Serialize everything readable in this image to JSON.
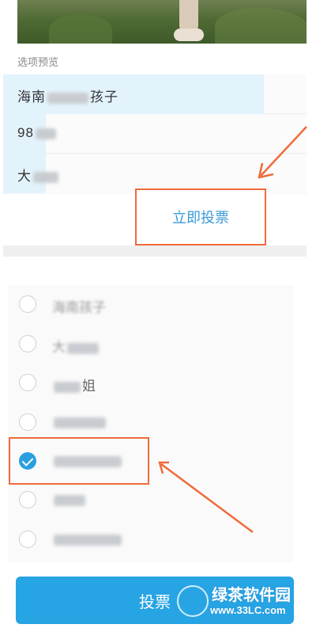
{
  "preview": {
    "label": "选项预览",
    "rows": [
      {
        "text_start": "海南",
        "text_end": "孩子",
        "fill": 0.86
      },
      {
        "text_start": "98",
        "text_end": "",
        "fill": 0.14
      },
      {
        "text_start": "大",
        "text_end": "",
        "fill": 0.14
      }
    ]
  },
  "vote_now_label": "立即投票",
  "options": [
    {
      "label": "海南孩子",
      "checked": false
    },
    {
      "label": "大",
      "checked": false
    },
    {
      "label": "姐",
      "checked": false
    },
    {
      "label": "",
      "checked": false
    },
    {
      "label": "",
      "checked": true
    },
    {
      "label": "",
      "checked": false
    },
    {
      "label": "",
      "checked": false
    }
  ],
  "vote_button_label": "投票",
  "watermark": {
    "brand": "绿茶软件园",
    "site": "www.33LC.com"
  },
  "colors": {
    "accent_blue": "#27a4e4",
    "annotation_orange": "#f06a3b",
    "preview_bar": "#e3f3fb"
  },
  "icons": [
    "radio-unchecked-icon",
    "radio-checked-icon",
    "annotation-arrow-icon"
  ]
}
